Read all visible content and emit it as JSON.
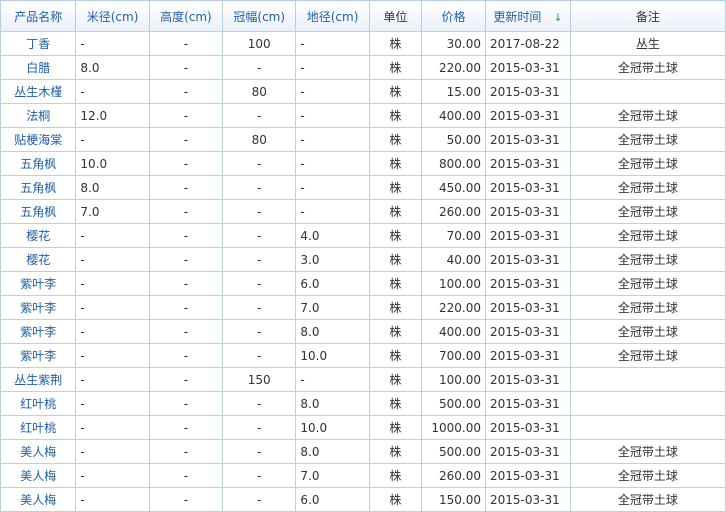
{
  "table": {
    "headers": [
      {
        "key": "name",
        "label": "产品名称",
        "sortable": true
      },
      {
        "key": "mi",
        "label": "米径(cm)",
        "sortable": true
      },
      {
        "key": "gao",
        "label": "高度(cm)",
        "sortable": true
      },
      {
        "key": "guan",
        "label": "冠幅(cm)",
        "sortable": true
      },
      {
        "key": "di",
        "label": "地径(cm)",
        "sortable": true
      },
      {
        "key": "unit",
        "label": "单位",
        "sortable": false
      },
      {
        "key": "price",
        "label": "价格",
        "sortable": true
      },
      {
        "key": "date",
        "label": "更新时间",
        "sortable": true
      },
      {
        "key": "note",
        "label": "备注",
        "sortable": false
      }
    ],
    "sort_indicator": "↓",
    "rows": [
      {
        "name": "丁香",
        "mi": "-",
        "gao": "-",
        "guan": "100",
        "di": "-",
        "unit": "株",
        "price": "30.00",
        "date": "2017-08-22",
        "note": "丛生"
      },
      {
        "name": "白腊",
        "mi": "8.0",
        "gao": "-",
        "guan": "-",
        "di": "-",
        "unit": "株",
        "price": "220.00",
        "date": "2015-03-31",
        "note": "全冠带土球"
      },
      {
        "name": "丛生木槿",
        "mi": "-",
        "gao": "-",
        "guan": "80",
        "di": "-",
        "unit": "株",
        "price": "15.00",
        "date": "2015-03-31",
        "note": ""
      },
      {
        "name": "法桐",
        "mi": "12.0",
        "gao": "-",
        "guan": "-",
        "di": "-",
        "unit": "株",
        "price": "400.00",
        "date": "2015-03-31",
        "note": "全冠带土球"
      },
      {
        "name": "贴梗海棠",
        "mi": "-",
        "gao": "-",
        "guan": "80",
        "di": "-",
        "unit": "株",
        "price": "50.00",
        "date": "2015-03-31",
        "note": "全冠带土球"
      },
      {
        "name": "五角枫",
        "mi": "10.0",
        "gao": "-",
        "guan": "-",
        "di": "-",
        "unit": "株",
        "price": "800.00",
        "date": "2015-03-31",
        "note": "全冠带土球"
      },
      {
        "name": "五角枫",
        "mi": "8.0",
        "gao": "-",
        "guan": "-",
        "di": "-",
        "unit": "株",
        "price": "450.00",
        "date": "2015-03-31",
        "note": "全冠带土球"
      },
      {
        "name": "五角枫",
        "mi": "7.0",
        "gao": "-",
        "guan": "-",
        "di": "-",
        "unit": "株",
        "price": "260.00",
        "date": "2015-03-31",
        "note": "全冠带土球"
      },
      {
        "name": "樱花",
        "mi": "-",
        "gao": "-",
        "guan": "-",
        "di": "4.0",
        "unit": "株",
        "price": "70.00",
        "date": "2015-03-31",
        "note": "全冠带土球"
      },
      {
        "name": "樱花",
        "mi": "-",
        "gao": "-",
        "guan": "-",
        "di": "3.0",
        "unit": "株",
        "price": "40.00",
        "date": "2015-03-31",
        "note": "全冠带土球"
      },
      {
        "name": "紫叶李",
        "mi": "-",
        "gao": "-",
        "guan": "-",
        "di": "6.0",
        "unit": "株",
        "price": "100.00",
        "date": "2015-03-31",
        "note": "全冠带土球"
      },
      {
        "name": "紫叶李",
        "mi": "-",
        "gao": "-",
        "guan": "-",
        "di": "7.0",
        "unit": "株",
        "price": "220.00",
        "date": "2015-03-31",
        "note": "全冠带土球"
      },
      {
        "name": "紫叶李",
        "mi": "-",
        "gao": "-",
        "guan": "-",
        "di": "8.0",
        "unit": "株",
        "price": "400.00",
        "date": "2015-03-31",
        "note": "全冠带土球"
      },
      {
        "name": "紫叶李",
        "mi": "-",
        "gao": "-",
        "guan": "-",
        "di": "10.0",
        "unit": "株",
        "price": "700.00",
        "date": "2015-03-31",
        "note": "全冠带土球"
      },
      {
        "name": "丛生紫荆",
        "mi": "-",
        "gao": "-",
        "guan": "150",
        "di": "-",
        "unit": "株",
        "price": "100.00",
        "date": "2015-03-31",
        "note": ""
      },
      {
        "name": "红叶桃",
        "mi": "-",
        "gao": "-",
        "guan": "-",
        "di": "8.0",
        "unit": "株",
        "price": "500.00",
        "date": "2015-03-31",
        "note": ""
      },
      {
        "name": "红叶桃",
        "mi": "-",
        "gao": "-",
        "guan": "-",
        "di": "10.0",
        "unit": "株",
        "price": "1000.00",
        "date": "2015-03-31",
        "note": ""
      },
      {
        "name": "美人梅",
        "mi": "-",
        "gao": "-",
        "guan": "-",
        "di": "8.0",
        "unit": "株",
        "price": "500.00",
        "date": "2015-03-31",
        "note": "全冠带土球"
      },
      {
        "name": "美人梅",
        "mi": "-",
        "gao": "-",
        "guan": "-",
        "di": "7.0",
        "unit": "株",
        "price": "260.00",
        "date": "2015-03-31",
        "note": "全冠带土球"
      },
      {
        "name": "美人梅",
        "mi": "-",
        "gao": "-",
        "guan": "-",
        "di": "6.0",
        "unit": "株",
        "price": "150.00",
        "date": "2015-03-31",
        "note": "全冠带土球"
      }
    ]
  },
  "colors": {
    "link": "#1f5fa8",
    "border": "#bcd0e5",
    "sort_arrow": "#2e9e3a"
  }
}
